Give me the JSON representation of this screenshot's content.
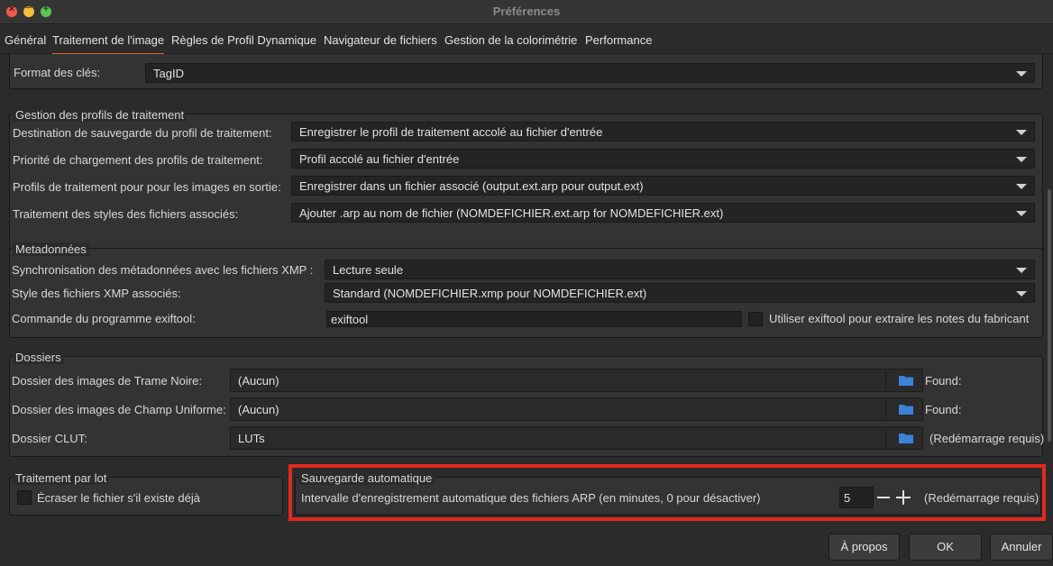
{
  "window": {
    "title": "Préférences"
  },
  "tabs": [
    {
      "label": "Général"
    },
    {
      "label": "Traitement de l'image"
    },
    {
      "label": "Règles de Profil Dynamique"
    },
    {
      "label": "Navigateur de fichiers"
    },
    {
      "label": "Gestion de la colorimétrie"
    },
    {
      "label": "Performance"
    }
  ],
  "keys_format": {
    "label": "Format des clés:",
    "value": "TagID"
  },
  "profiles": {
    "title": "Gestion des profils de traitement",
    "rows": [
      {
        "label": "Destination de sauvegarde du profil de traitement:",
        "value": "Enregistrer le profil de traitement accolé au fichier d'entrée"
      },
      {
        "label": "Priorité de chargement des profils de traitement:",
        "value": "Profil accolé au fichier d'entrée"
      },
      {
        "label": "Profils de traitement pour pour les images en sortie:",
        "value": "Enregistrer dans un fichier associé (output.ext.arp pour output.ext)"
      },
      {
        "label": "Traitement des styles des fichiers associés:",
        "value": "Ajouter .arp au nom de fichier (NOMDEFICHIER.ext.arp for NOMDEFICHIER.ext)"
      }
    ]
  },
  "metadata": {
    "title": "Metadonnées",
    "sync": {
      "label": "Synchronisation des métadonnées avec les fichiers XMP :",
      "value": "Lecture seule"
    },
    "xmp_style": {
      "label": "Style des fichiers XMP associés:",
      "value": "Standard (NOMDEFICHIER.xmp pour NOMDEFICHIER.ext)"
    },
    "exiftool": {
      "label": "Commande du programme exiftool:",
      "value": "exiftool",
      "checkbox_label": "Utiliser exiftool pour extraire les notes du fabricant"
    }
  },
  "folders": {
    "title": "Dossiers",
    "rows": [
      {
        "label": "Dossier des images de Trame Noire:",
        "value": "(Aucun)",
        "status": "Found:"
      },
      {
        "label": "Dossier des images de Champ Uniforme:",
        "value": "(Aucun)",
        "status": "Found:"
      },
      {
        "label": "Dossier CLUT:",
        "value": "LUTs",
        "status": "(Redémarrage requis)"
      }
    ]
  },
  "batch": {
    "title": "Traitement par lot",
    "checkbox_label": "Écraser le fichier s'il existe déjà"
  },
  "autosave": {
    "title": "Sauvegarde automatique",
    "label": "Intervalle d'enregistrement automatique des fichiers ARP (en minutes, 0 pour désactiver)",
    "value": "5",
    "note": "(Redémarrage requis)"
  },
  "buttons": {
    "about": "À propos",
    "ok": "OK",
    "cancel": "Annuler"
  },
  "colors": {
    "accent": "#d9652a",
    "highlight": "#e02a1f",
    "folder_icon": "#3b82d8"
  }
}
